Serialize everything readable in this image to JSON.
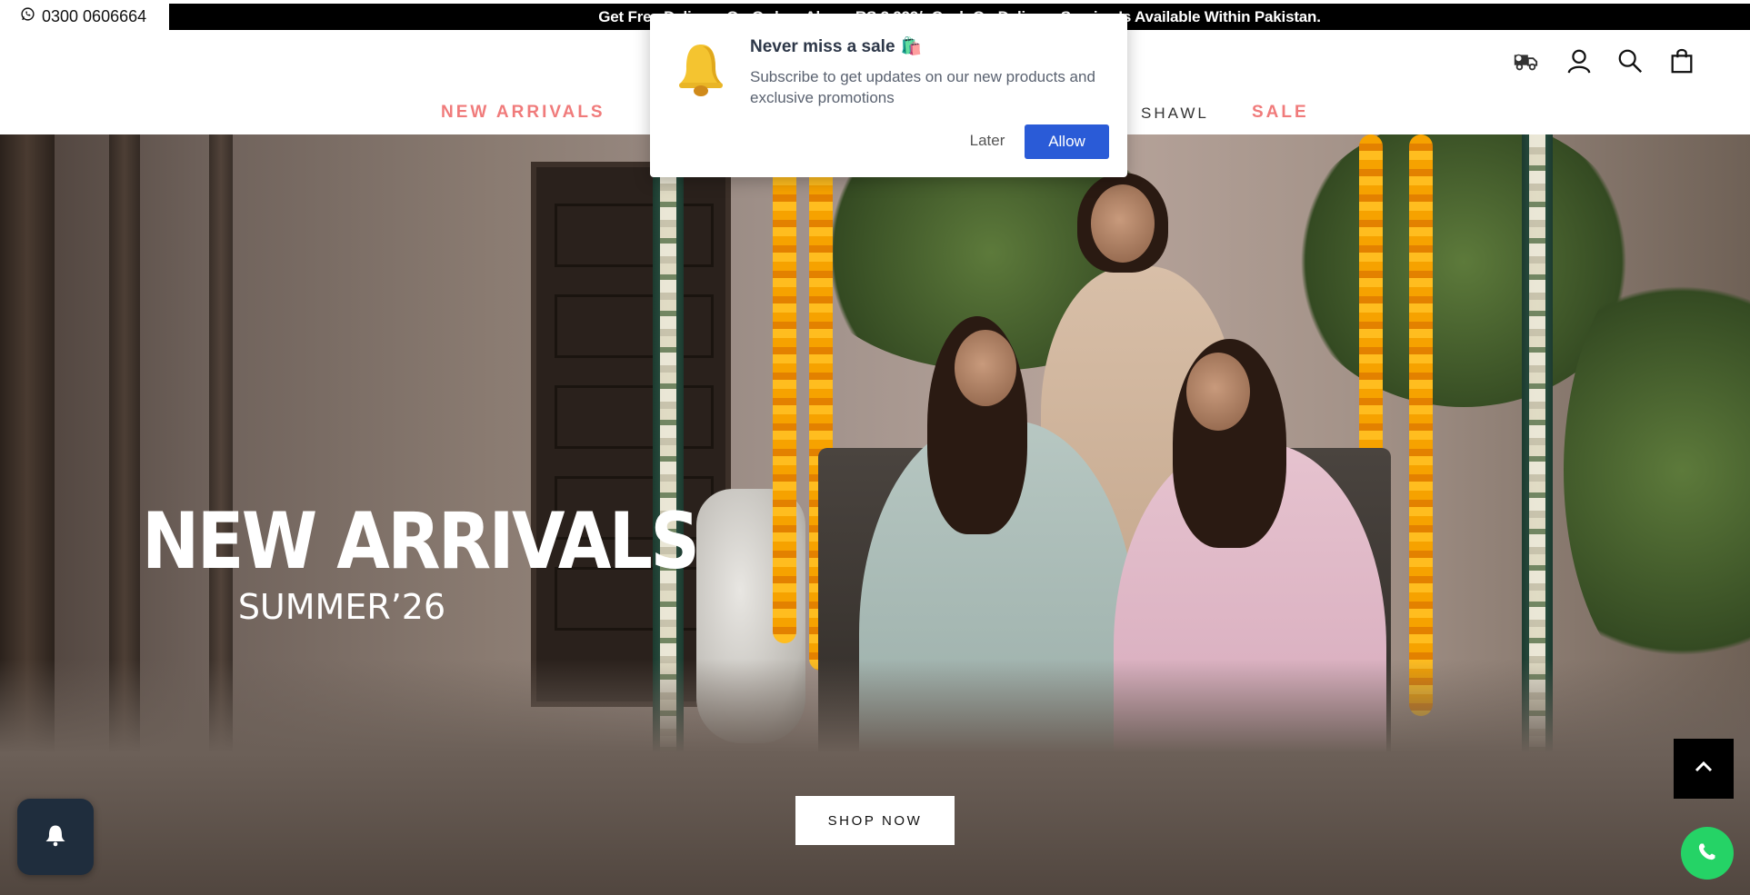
{
  "topbar": {
    "phone": "0300 0606664",
    "phone_icon": "whatsapp-icon",
    "announcement": "Get Free Delivery On Orders Above RS.3,999/- Cash On Delivery Service Is Available Within Pakistan."
  },
  "nav": {
    "items": [
      {
        "label": "NEW ARRIVALS",
        "color": "#f07b7b"
      },
      {
        "label": "SHAWL",
        "color": "#333333"
      },
      {
        "label": "SALE",
        "color": "#f07b7b"
      }
    ]
  },
  "header_icons": [
    "delivery-truck-icon",
    "account-icon",
    "search-icon",
    "cart-icon"
  ],
  "hero": {
    "title": "NEW ARRIVALS",
    "subtitle": "SUMMER’26",
    "cta": "SHOP NOW"
  },
  "popup": {
    "title": "Never miss a sale",
    "title_emoji": "🛍️",
    "body": "Subscribe to get updates on our new products and exclusive promotions",
    "later": "Later",
    "allow": "Allow",
    "allow_color": "#2a5bd7"
  },
  "widgets": {
    "notification": "bell-icon",
    "scroll_top": "chevron-up-icon",
    "chat": "whatsapp-icon"
  }
}
